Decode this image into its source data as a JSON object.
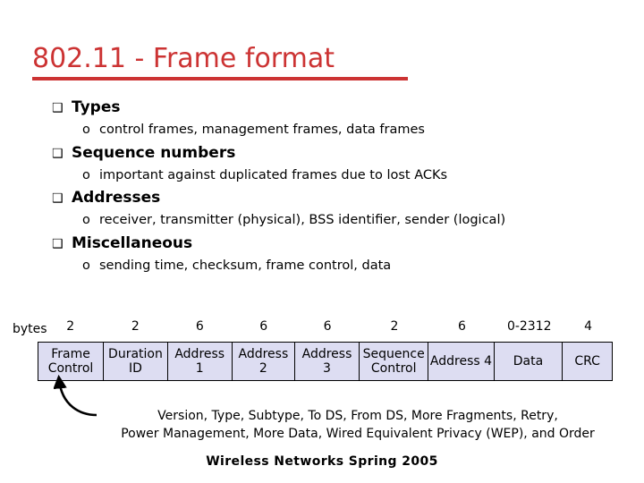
{
  "slide": {
    "title": "802.11 - Frame format",
    "title_color": "#CC3333",
    "footer": "Wireless Networks Spring 2005"
  },
  "bullets": [
    {
      "marker": "❑",
      "text": "Types",
      "sub": [
        {
          "marker": "o",
          "text": "control frames, management frames, data frames"
        }
      ]
    },
    {
      "marker": "❑",
      "text": "Sequence numbers",
      "sub": [
        {
          "marker": "o",
          "text": "important against duplicated frames due to lost ACKs"
        }
      ]
    },
    {
      "marker": "❑",
      "text": "Addresses",
      "sub": [
        {
          "marker": "o",
          "text": "receiver, transmitter (physical), BSS identifier, sender (logical)"
        }
      ]
    },
    {
      "marker": "❑",
      "text": "Miscellaneous",
      "sub": [
        {
          "marker": "o",
          "text": "sending time, checksum, frame control, data"
        }
      ]
    }
  ],
  "frame_diagram": {
    "unit_label": "bytes",
    "cell_fill": "#DDDDF2",
    "fields": [
      {
        "size": "2",
        "name": "Frame Control",
        "width_pct": 11.4
      },
      {
        "size": "2",
        "name": "Duration ID",
        "width_pct": 11.2
      },
      {
        "size": "6",
        "name": "Address 1",
        "width_pct": 11.2
      },
      {
        "size": "6",
        "name": "Address 2",
        "width_pct": 11.0
      },
      {
        "size": "6",
        "name": "Address 3",
        "width_pct": 11.2
      },
      {
        "size": "2",
        "name": "Sequence Control",
        "width_pct": 12.1
      },
      {
        "size": "6",
        "name": "Address 4",
        "width_pct": 11.4
      },
      {
        "size": "0-2312",
        "name": "Data",
        "width_pct": 12.0
      },
      {
        "size": "4",
        "name": "CRC",
        "width_pct": 8.5
      }
    ]
  },
  "annotation": {
    "line1": "Version, Type, Subtype, To DS, From DS, More Fragments, Retry,",
    "line2": "Power Management, More Data, Wired Equivalent Privacy (WEP), and Order"
  }
}
